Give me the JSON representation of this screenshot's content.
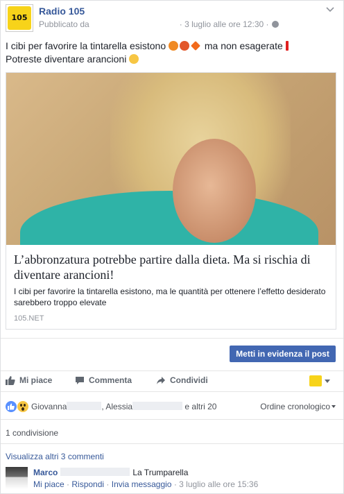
{
  "post": {
    "page_name": "Radio 105",
    "avatar_text": "105",
    "published_by": "Pubblicato da",
    "timestamp": "3 luglio alle ore 12:30",
    "separator": "·",
    "message_line1": "I cibi per favorire la tintarella esistono",
    "message_line1_suffix": "ma non esagerate",
    "message_line2": "Potreste diventare arancioni",
    "emoji_colors": [
      "#f08a24",
      "#e2572b",
      "#f26a1b",
      "#e02020",
      "#f7c644"
    ]
  },
  "link_preview": {
    "title": "L’abbronzatura potrebbe partire dalla dieta. Ma si rischia di diventare arancioni!",
    "description": "I cibi per favorire la tintarella esistono, ma le quantità per ottenere l’effetto desiderato sarebbero troppo elevate",
    "domain": "105.NET"
  },
  "boost_button": "Metti in evidenza il post",
  "actions": {
    "like": "Mi piace",
    "comment": "Commenta",
    "share": "Condividi"
  },
  "reactions": {
    "name1": "Giovanna",
    "name2": "Alessia",
    "others": "e altri 20",
    "order": "Ordine cronologico"
  },
  "shares": "1 condivisione",
  "more_comments": "Visualizza altri 3 commenti",
  "comment": {
    "author": "Marco",
    "text": "La Trumparella",
    "like": "Mi piace",
    "reply": "Rispondi",
    "message": "Invia messaggio",
    "timestamp": "3 luglio alle ore 15:36",
    "sep": "·"
  },
  "colors": {
    "link_blue": "#365899",
    "primary_button": "#4267b2",
    "brand_yellow": "#f7d31a"
  }
}
